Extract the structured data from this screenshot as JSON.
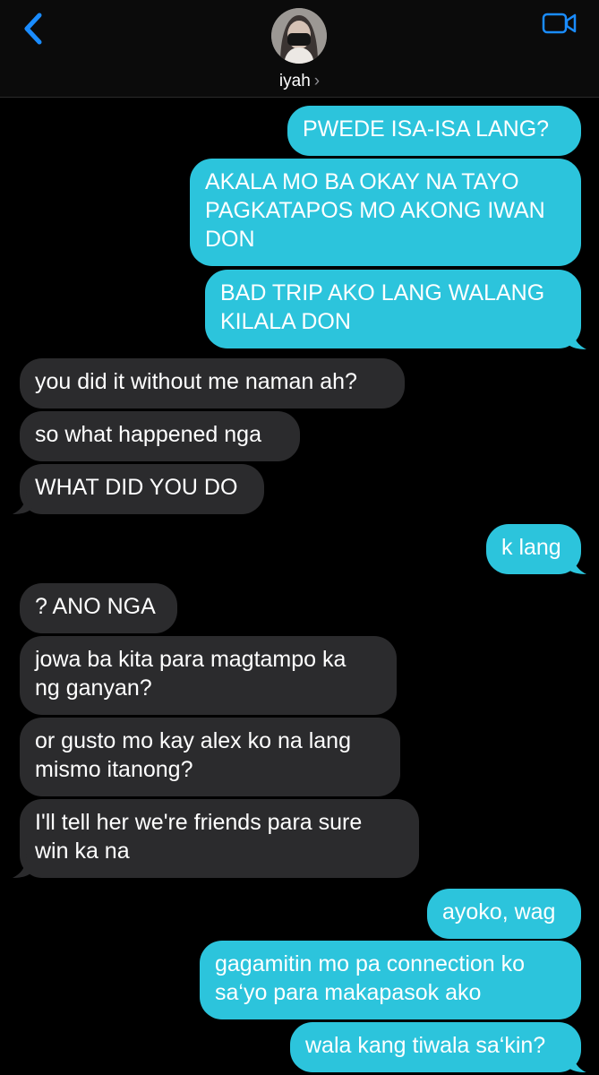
{
  "header": {
    "contact_name": "iyah",
    "chevron": "›",
    "back_icon": "chevron-left-icon",
    "video_icon": "video-camera-icon",
    "accent": "#1a8cff"
  },
  "colors": {
    "outgoing": "#2cc4dc",
    "incoming": "#2b2b2d",
    "background": "#000000"
  },
  "messages": [
    {
      "from": "me",
      "lines": [
        "PWEDE ISA-ISA LANG?"
      ]
    },
    {
      "from": "me",
      "lines": [
        "AKALA MO BA OKAY NA TAYO",
        "PAGKATAPOS MO AKONG IWAN",
        "DON"
      ]
    },
    {
      "from": "me",
      "lines": [
        "BAD TRIP AKO LANG WALANG",
        "KILALA DON"
      ]
    },
    {
      "from": "them",
      "lines": [
        "you did it without me naman ah?"
      ]
    },
    {
      "from": "them",
      "lines": [
        "so what happened nga"
      ]
    },
    {
      "from": "them",
      "lines": [
        "WHAT DID YOU DO"
      ]
    },
    {
      "from": "me",
      "lines": [
        "k lang"
      ]
    },
    {
      "from": "them",
      "lines": [
        "? ANO NGA"
      ]
    },
    {
      "from": "them",
      "lines": [
        "jowa ba kita para magtampo ka",
        "ng ganyan?"
      ]
    },
    {
      "from": "them",
      "lines": [
        "or gusto mo kay alex ko na lang",
        "mismo itanong?"
      ]
    },
    {
      "from": "them",
      "lines": [
        "I'll tell her we're friends para sure",
        "win ka na"
      ]
    },
    {
      "from": "me",
      "lines": [
        "ayoko, wag"
      ]
    },
    {
      "from": "me",
      "lines": [
        "gagamitin mo pa connection ko",
        "sa‘yo para makapasok ako"
      ]
    },
    {
      "from": "me",
      "lines": [
        "wala kang tiwala sa‘kin?"
      ]
    }
  ]
}
